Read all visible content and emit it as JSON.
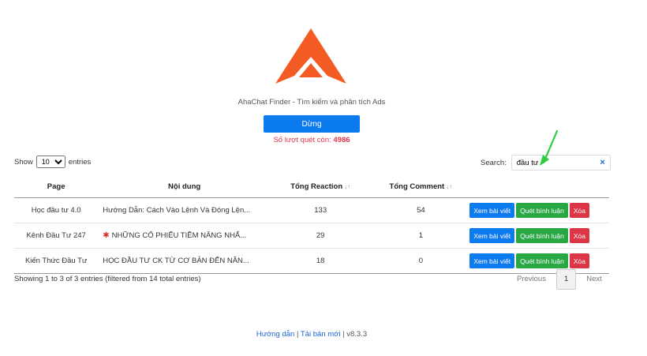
{
  "app": {
    "subtitle": "AhaChat Finder - Tìm kiếm và phân tích Ads",
    "stop_label": "Dừng",
    "remaining_label": "Số lượt quét còn:",
    "remaining_value": "4986",
    "brand_color": "#f35a24"
  },
  "controls": {
    "show_label": "Show",
    "length_value": "10",
    "entries_label": "entries",
    "search_label": "Search:",
    "search_value": "đầu tư",
    "clear_icon": "×"
  },
  "table": {
    "headers": [
      "Page",
      "Nội dung",
      "Tổng Reaction",
      "Tổng Comment"
    ],
    "rows": [
      {
        "page": "Học đầu tư 4.0",
        "content": "Hướng Dẫn: Cách Vào Lệnh Và Đóng Lện...",
        "reaction": "133",
        "comment": "54"
      },
      {
        "page": "Kênh Đầu Tư 247",
        "content": "NHỮNG CỔ PHIẾU TIỀM NĂNG NHẤ...",
        "reaction": "29",
        "comment": "1"
      },
      {
        "page": "Kiến Thức Đầu Tư",
        "content": "HỌC ĐẦU TƯ CK TỪ CƠ BẢN ĐẾN NÂN...",
        "reaction": "18",
        "comment": "0"
      }
    ],
    "actions": {
      "view": "Xem bài viết",
      "scan": "Quét bình luận",
      "delete": "Xóa"
    }
  },
  "footer_info": {
    "showing": "Showing 1 to 3 of 3 entries (filtered from 14 total entries)",
    "previous": "Previous",
    "current_page": "1",
    "next": "Next"
  },
  "footer": {
    "guide": "Hướng dẫn",
    "separator": "|",
    "reinstall": "Tải bản mới",
    "version": "| v8.3.3"
  }
}
